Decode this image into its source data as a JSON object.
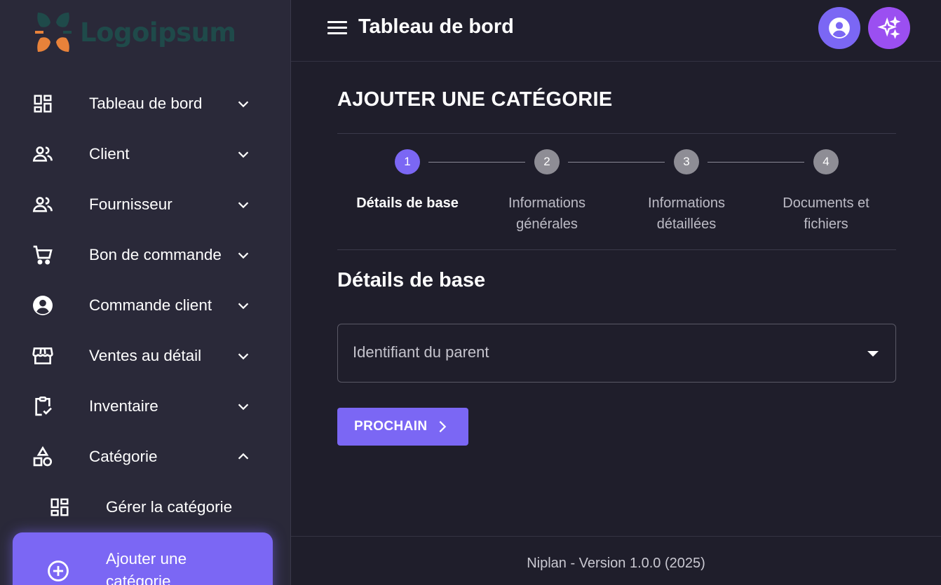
{
  "brand": {
    "name": "Logoipsum"
  },
  "sidebar": {
    "items": [
      {
        "label": "Tableau de bord",
        "icon": "dashboard-icon",
        "expanded": false
      },
      {
        "label": "Client",
        "icon": "people-icon",
        "expanded": false
      },
      {
        "label": "Fournisseur",
        "icon": "people-icon",
        "expanded": false
      },
      {
        "label": "Bon de commande",
        "icon": "cart-icon",
        "expanded": false
      },
      {
        "label": "Commande client",
        "icon": "account-circle-icon",
        "expanded": false
      },
      {
        "label": "Ventes au détail",
        "icon": "store-icon",
        "expanded": false
      },
      {
        "label": "Inventaire",
        "icon": "clipboard-check-icon",
        "expanded": false
      },
      {
        "label": "Catégorie",
        "icon": "shapes-icon",
        "expanded": true
      }
    ],
    "subitems": [
      {
        "label": "Gérer la catégorie",
        "icon": "dashboard-icon"
      },
      {
        "label": "Ajouter une catégorie",
        "icon": "add-circle-icon",
        "active": true
      }
    ]
  },
  "header": {
    "title": "Tableau de bord"
  },
  "page": {
    "title": "AJOUTER UNE CATÉGORIE",
    "steps": [
      {
        "number": "1",
        "label": "Détails de base",
        "active": true
      },
      {
        "number": "2",
        "label": "Informations générales",
        "active": false
      },
      {
        "number": "3",
        "label": "Informations détaillées",
        "active": false
      },
      {
        "number": "4",
        "label": "Documents et fichiers",
        "active": false
      }
    ],
    "section_title": "Détails de base",
    "parent_select": {
      "placeholder": "Identifiant du parent",
      "value": ""
    },
    "next_button": "PROCHAIN"
  },
  "footer": {
    "text": "Niplan - Version 1.0.0 (2025)"
  },
  "colors": {
    "accent": "#7b67f4",
    "ai_button": "#9b4ff1",
    "sidebar_bg": "#2a2939",
    "main_bg": "#1f1e2b",
    "step_inactive": "#8e8d95",
    "logo_green": "#1f4a4a",
    "logo_orange": "#e8823a"
  }
}
